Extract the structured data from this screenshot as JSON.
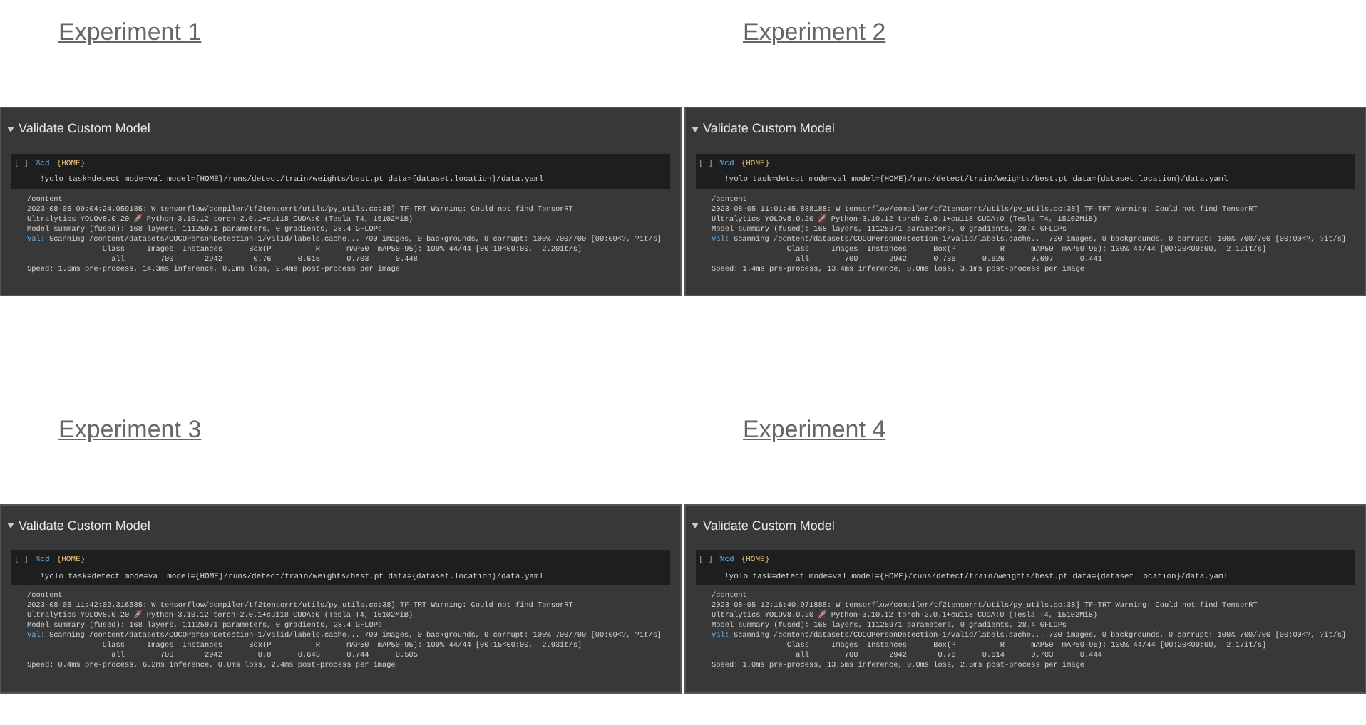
{
  "experiments": [
    {
      "title": "Experiment 1",
      "section_title": "Validate Custom Model",
      "prompt": "[ ]",
      "magic": "%cd",
      "magic_arg": "{HOME}",
      "command": "!yolo task=detect mode=val model={HOME}/runs/detect/train/weights/best.pt data={dataset.location}/data.yaml",
      "output": [
        {
          "text": "/content"
        },
        {
          "text": "2023-08-05 09:04:24.059185: W tensorflow/compiler/tf2tensorrt/utils/py_utils.cc:38] TF-TRT Warning: Could not find TensorRT"
        },
        {
          "text": "Ultralytics YOLOv8.0.20 🚀 Python-3.10.12 torch-2.0.1+cu118 CUDA:0 (Tesla T4, 15102MiB)"
        },
        {
          "text": "Model summary (fused): 168 layers, 11125971 parameters, 0 gradients, 28.4 GFLOPs"
        },
        {
          "prefix": "val:",
          "text": "Scanning /content/datasets/COCOPersonDetection-1/valid/labels.cache... 700 images, 0 backgrounds, 0 corrupt: 100% 700/700 [00:00<?, ?it/s]"
        },
        {
          "text": "                 Class     Images  Instances      Box(P          R      mAP50  mAP50-95): 100% 44/44 [00:19<00:00,  2.20it/s]"
        },
        {
          "text": "                   all        700       2942       0.76      0.616      0.703      0.448"
        },
        {
          "text": "Speed: 1.6ms pre-process, 14.3ms inference, 0.0ms loss, 2.4ms post-process per image"
        }
      ]
    },
    {
      "title": "Experiment 2",
      "section_title": "Validate Custom Model",
      "prompt": "[ ]",
      "magic": "%cd",
      "magic_arg": "{HOME}",
      "command": "!yolo task=detect mode=val model={HOME}/runs/detect/train/weights/best.pt data={dataset.location}/data.yaml",
      "output": [
        {
          "text": "/content"
        },
        {
          "text": "2023-08-05 11:01:45.888188: W tensorflow/compiler/tf2tensorrt/utils/py_utils.cc:38] TF-TRT Warning: Could not find TensorRT"
        },
        {
          "text": "Ultralytics YOLOv8.0.20 🚀 Python-3.10.12 torch-2.0.1+cu118 CUDA:0 (Tesla T4, 15102MiB)"
        },
        {
          "text": "Model summary (fused): 168 layers, 11125971 parameters, 0 gradients, 28.4 GFLOPs"
        },
        {
          "prefix": "val:",
          "text": "Scanning /content/datasets/COCOPersonDetection-1/valid/labels.cache... 700 images, 0 backgrounds, 0 corrupt: 100% 700/700 [00:00<?, ?it/s]"
        },
        {
          "text": "                 Class     Images  Instances      Box(P          R      mAP50  mAP50-95): 100% 44/44 [00:20<00:00,  2.12it/s]"
        },
        {
          "text": "                   all        700       2942      0.736      0.626      0.697      0.441"
        },
        {
          "text": "Speed: 1.4ms pre-process, 13.4ms inference, 0.0ms loss, 3.1ms post-process per image"
        }
      ]
    },
    {
      "title": "Experiment 3",
      "section_title": "Validate Custom Model",
      "prompt": "[ ]",
      "magic": "%cd",
      "magic_arg": "{HOME}",
      "command": "!yolo task=detect mode=val model={HOME}/runs/detect/train/weights/best.pt data={dataset.location}/data.yaml",
      "output": [
        {
          "text": "/content"
        },
        {
          "text": "2023-08-05 11:42:02.316585: W tensorflow/compiler/tf2tensorrt/utils/py_utils.cc:38] TF-TRT Warning: Could not find TensorRT"
        },
        {
          "text": "Ultralytics YOLOv8.0.20 🚀 Python-3.10.12 torch-2.0.1+cu118 CUDA:0 (Tesla T4, 15102MiB)"
        },
        {
          "text": "Model summary (fused): 168 layers, 11125971 parameters, 0 gradients, 28.4 GFLOPs"
        },
        {
          "prefix": "val:",
          "text": "Scanning /content/datasets/COCOPersonDetection-1/valid/labels.cache... 700 images, 0 backgrounds, 0 corrupt: 100% 700/700 [00:00<?, ?it/s]"
        },
        {
          "text": "                 Class     Images  Instances      Box(P          R      mAP50  mAP50-95): 100% 44/44 [00:15<00:00,  2.93it/s]"
        },
        {
          "text": "                   all        700       2942        0.8      0.643      0.744      0.505"
        },
        {
          "text": "Speed: 0.4ms pre-process, 6.2ms inference, 0.0ms loss, 2.4ms post-process per image"
        }
      ]
    },
    {
      "title": "Experiment 4",
      "section_title": "Validate Custom Model",
      "prompt": "[ ]",
      "magic": "%cd",
      "magic_arg": "{HOME}",
      "command": "!yolo task=detect mode=val model={HOME}/runs/detect/train/weights/best.pt data={dataset.location}/data.yaml",
      "output": [
        {
          "text": "/content"
        },
        {
          "text": "2023-08-05 12:16:40.971888: W tensorflow/compiler/tf2tensorrt/utils/py_utils.cc:38] TF-TRT Warning: Could not find TensorRT"
        },
        {
          "text": "Ultralytics YOLOv8.0.20 🚀 Python-3.10.12 torch-2.0.1+cu118 CUDA:0 (Tesla T4, 15102MiB)"
        },
        {
          "text": "Model summary (fused): 168 layers, 11125971 parameters, 0 gradients, 28.4 GFLOPs"
        },
        {
          "prefix": "val:",
          "text": "Scanning /content/datasets/COCOPersonDetection-1/valid/labels.cache... 700 images, 0 backgrounds, 0 corrupt: 100% 700/700 [00:00<?, ?it/s]"
        },
        {
          "text": "                 Class     Images  Instances      Box(P          R      mAP50  mAP50-95): 100% 44/44 [00:20<00:00,  2.17it/s]"
        },
        {
          "text": "                   all        700       2942       0.76      0.614      0.703      0.444"
        },
        {
          "text": "Speed: 1.0ms pre-process, 13.5ms inference, 0.0ms loss, 2.5ms post-process per image"
        }
      ]
    }
  ]
}
